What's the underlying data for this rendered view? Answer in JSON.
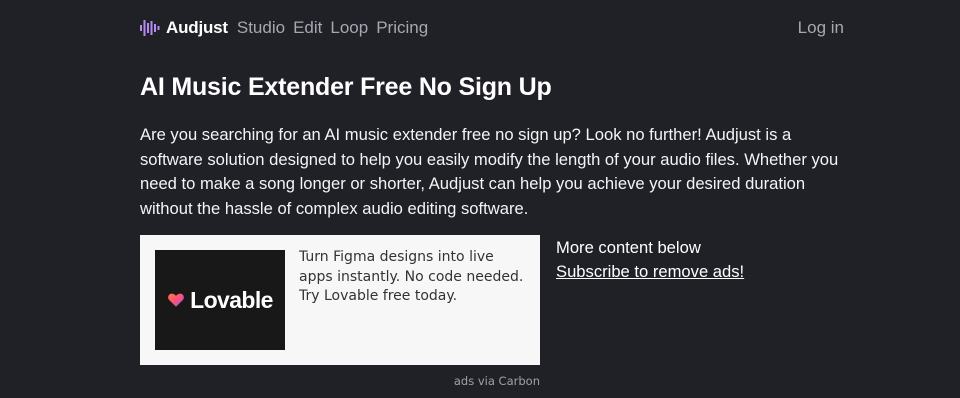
{
  "header": {
    "brand": "Audjust",
    "nav": [
      "Studio",
      "Edit",
      "Loop",
      "Pricing"
    ],
    "login": "Log in",
    "colors": {
      "logo_accent": "#b48cf0",
      "nav_text": "#a7a7b2",
      "background": "#202027"
    }
  },
  "main": {
    "title": "AI Music Extender Free No Sign Up",
    "intro": "Are you searching for an AI music extender free no sign up? Look no further! Audjust is a software solution designed to help you easily modify the length of your audio files. Whether you need to make a song longer or shorter, Audjust can help you achieve your desired duration without the hassle of complex audio editing software."
  },
  "ad": {
    "brand": "Lovable",
    "text": "Turn Figma designs into live apps instantly. No code needed. Try Lovable free today.",
    "via": "ads via Carbon",
    "icon": "heart-icon"
  },
  "side": {
    "more": "More content below",
    "subscribe": "Subscribe to remove ads!"
  }
}
